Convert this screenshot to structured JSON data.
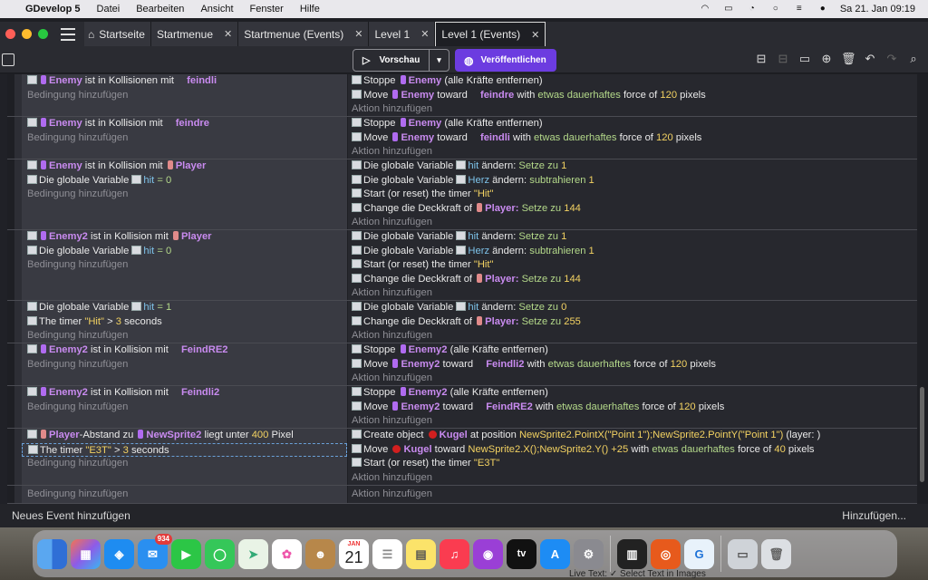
{
  "menubar": {
    "apple": "",
    "app_name": "GDevelop 5",
    "items": [
      "Datei",
      "Bearbeiten",
      "Ansicht",
      "Fenster",
      "Hilfe"
    ],
    "clock": "Sa 21. Jan  09:19"
  },
  "tabs": [
    {
      "label": "Startseite",
      "closable": false
    },
    {
      "label": "Startmenue",
      "closable": true
    },
    {
      "label": "Startmenue (Events)",
      "closable": true
    },
    {
      "label": "Level 1",
      "closable": true
    },
    {
      "label": "Level 1 (Events)",
      "closable": true,
      "active": true
    }
  ],
  "toolbar": {
    "preview_label": "Vorschau",
    "publish_label": "Veröffentlichen"
  },
  "colors": {
    "accent": "#6c3ce0",
    "object": "#c98bf0",
    "variable": "#7ec3ea",
    "number": "#f3d262",
    "keyword": "#b4d98a"
  },
  "add_condition": "Bedingung hinzufügen",
  "add_action": "Aktion hinzufügen",
  "events": {
    "e1": {
      "c1": {
        "obj": "Enemy",
        "t1": "ist in Kollisionen mit",
        "obj2": "feindli"
      },
      "a1": {
        "t1": "Stoppe",
        "obj": "Enemy",
        "t2": "(alle Kräfte entfernen)"
      },
      "a2": {
        "t1": "Move",
        "obj": "Enemy",
        "t2": "toward",
        "obj2": "feindre",
        "t3": "with",
        "kw": "etwas dauerhaftes",
        "t4": "force of",
        "num": "120",
        "t5": "pixels"
      }
    },
    "e2": {
      "c1": {
        "obj": "Enemy",
        "t1": "ist in Kollision mit",
        "obj2": "feindre"
      },
      "a1": {
        "t1": "Stoppe",
        "obj": "Enemy",
        "t2": "(alle Kräfte entfernen)"
      },
      "a2": {
        "t1": "Move",
        "obj": "Enemy",
        "t2": "toward",
        "obj2": "feindli",
        "t3": "with",
        "kw": "etwas dauerhaftes",
        "t4": "force of",
        "num": "120",
        "t5": "pixels"
      }
    },
    "e3": {
      "c1": {
        "obj": "Enemy",
        "t1": "ist in Kollision mit",
        "obj2": "Player"
      },
      "c2": {
        "t1": "Die globale Variable",
        "var": "hit",
        "op": "= 0"
      },
      "a1": {
        "t1": "Die globale Variable",
        "var": "hit",
        "t2": "ändern:",
        "kw": "Setze zu",
        "num": "1"
      },
      "a2": {
        "t1": "Die globale Variable",
        "var": "Herz",
        "t2": "ändern:",
        "kw": "subtrahieren",
        "num": "1"
      },
      "a3": {
        "t1": "Start (or reset) the timer",
        "str": "\"Hit\""
      },
      "a4": {
        "t1": "Change die Deckkraft of",
        "obj": "Player:",
        "kw": "Setze zu",
        "num": "144"
      }
    },
    "e4": {
      "c1": {
        "obj": "Enemy2",
        "t1": "ist in Kollision mit",
        "obj2": "Player"
      },
      "c2": {
        "t1": "Die globale Variable",
        "var": "hit",
        "op": "= 0"
      },
      "a1": {
        "t1": "Die globale Variable",
        "var": "hit",
        "t2": "ändern:",
        "kw": "Setze zu",
        "num": "1"
      },
      "a2": {
        "t1": "Die globale Variable",
        "var": "Herz",
        "t2": "ändern:",
        "kw": "subtrahieren",
        "num": "1"
      },
      "a3": {
        "t1": "Start (or reset) the timer",
        "str": "\"Hit\""
      },
      "a4": {
        "t1": "Change die Deckkraft of",
        "obj": "Player:",
        "kw": "Setze zu",
        "num": "144"
      }
    },
    "e5": {
      "c1": {
        "t1": "Die globale Variable",
        "var": "hit",
        "op": "= 1"
      },
      "c2": {
        "t1": "The timer",
        "str": "\"Hit\"",
        "op": ">",
        "num": "3",
        "t2": "seconds"
      },
      "a1": {
        "t1": "Die globale Variable",
        "var": "hit",
        "t2": "ändern:",
        "kw": "Setze zu",
        "num": "0"
      },
      "a2": {
        "t1": "Change die Deckkraft of",
        "obj": "Player:",
        "kw": "Setze zu",
        "num": "255"
      }
    },
    "e6": {
      "c1": {
        "obj": "Enemy2",
        "t1": "ist in Kollision mit",
        "obj2": "FeindRE2"
      },
      "a1": {
        "t1": "Stoppe",
        "obj": "Enemy2",
        "t2": "(alle Kräfte entfernen)"
      },
      "a2": {
        "t1": "Move",
        "obj": "Enemy2",
        "t2": "toward",
        "obj2": "Feindli2",
        "t3": "with",
        "kw": "etwas dauerhaftes",
        "t4": "force of",
        "num": "120",
        "t5": "pixels"
      }
    },
    "e7": {
      "c1": {
        "obj": "Enemy2",
        "t1": "ist in Kollision mit",
        "obj2": "Feindli2"
      },
      "a1": {
        "t1": "Stoppe",
        "obj": "Enemy2",
        "t2": "(alle Kräfte entfernen)"
      },
      "a2": {
        "t1": "Move",
        "obj": "Enemy2",
        "t2": "toward",
        "obj2": "FeindRE2",
        "t3": "with",
        "kw": "etwas dauerhaftes",
        "t4": "force of",
        "num": "120",
        "t5": "pixels"
      }
    },
    "e8": {
      "c1": {
        "obj": "Player",
        "t1": "-Abstand zu",
        "obj2": "NewSprite2",
        "t2": "liegt unter",
        "num": "400",
        "t3": "Pixel"
      },
      "c2": {
        "t1": "The timer",
        "str": "\"E3T\"",
        "op": ">",
        "num": "3",
        "t2": "seconds"
      },
      "a1": {
        "t1": "Create object",
        "obj": "Kugel",
        "t2": "at position",
        "expr": "NewSprite2.PointX(\"Point 1\");NewSprite2.PointY(\"Point 1\")",
        "t3": "(layer: )"
      },
      "a2": {
        "t1": "Move",
        "obj": "Kugel",
        "t2": "toward",
        "expr": "NewSprite2.X();NewSprite2.Y() +25",
        "t3": "with",
        "kw": "etwas dauerhaftes",
        "t4": "force of",
        "num": "40",
        "t5": "pixels"
      },
      "a3": {
        "t1": "Start (or reset) the timer",
        "str": "\"E3T\""
      }
    }
  },
  "footer": {
    "new_event": "Neues Event hinzufügen",
    "add_more": "Hinzufügen..."
  },
  "dock": {
    "mail_badge": "934",
    "cal_month": "JAN",
    "cal_day": "21",
    "tv_label": "tv"
  },
  "behind_text": "Live Text:  ✓  Select Text in Images"
}
